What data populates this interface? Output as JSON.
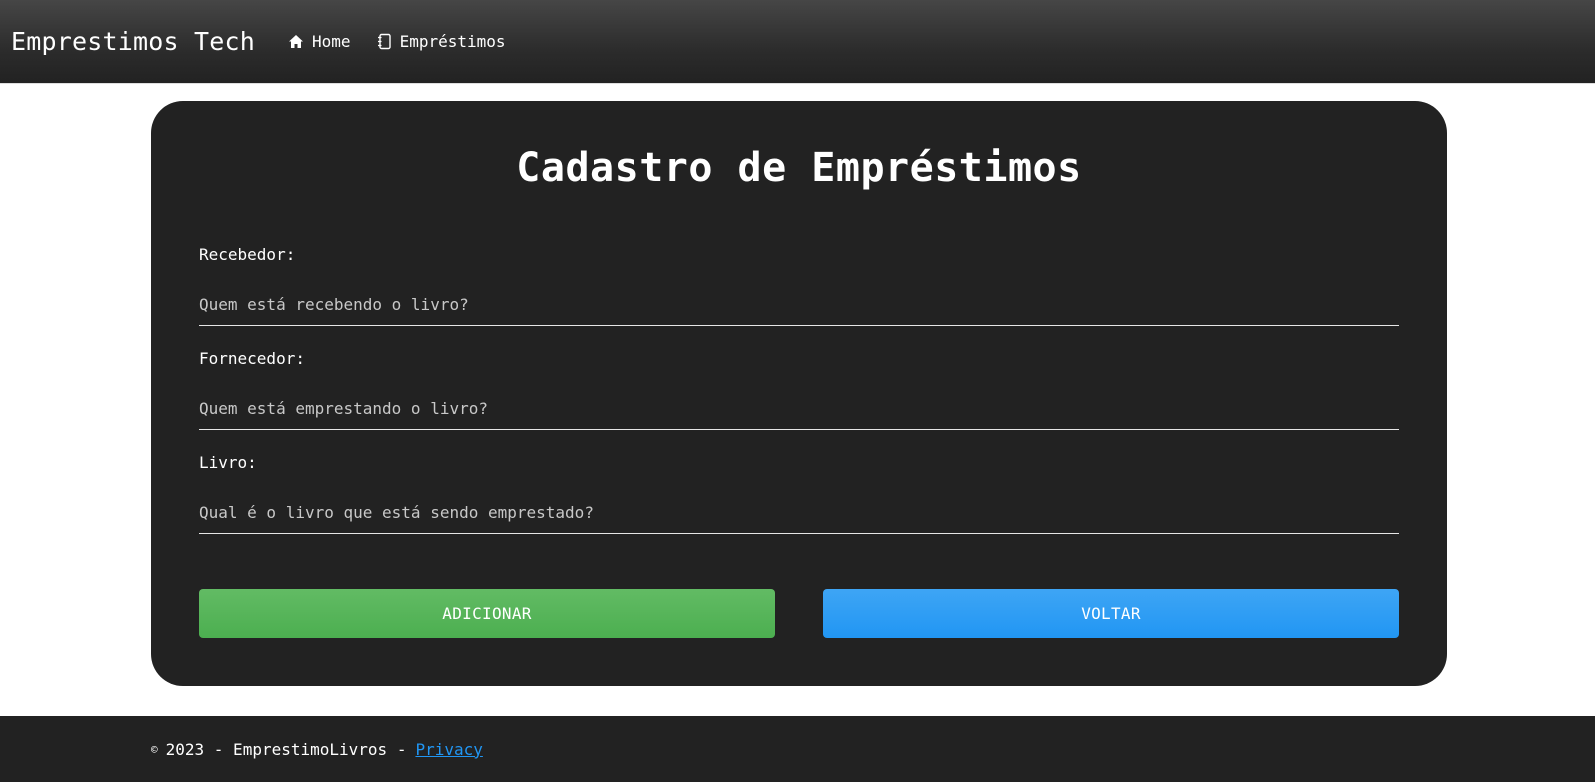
{
  "navbar": {
    "brand": "Emprestimos Tech",
    "links": [
      {
        "label": "Home",
        "icon": "home-icon"
      },
      {
        "label": "Empréstimos",
        "icon": "notebook-icon"
      }
    ]
  },
  "form": {
    "title": "Cadastro de Empréstimos",
    "fields": [
      {
        "label": "Recebedor:",
        "value": "",
        "placeholder": "Quem está recebendo o livro?"
      },
      {
        "label": "Fornecedor:",
        "value": "",
        "placeholder": "Quem está emprestando o livro?"
      },
      {
        "label": "Livro:",
        "value": "",
        "placeholder": "Qual é o livro que está sendo emprestado?"
      }
    ],
    "add_button": "ADICIONAR",
    "back_button": "VOLTAR"
  },
  "footer": {
    "copyright_symbol": "©",
    "text": "2023 - EmprestimoLivros -",
    "privacy_link": "Privacy"
  },
  "colors": {
    "navbar_bg": "#2c2c2c",
    "card_bg": "#222222",
    "add_button": "#4caf50",
    "back_button": "#2196f3",
    "link": "#2196f3"
  }
}
